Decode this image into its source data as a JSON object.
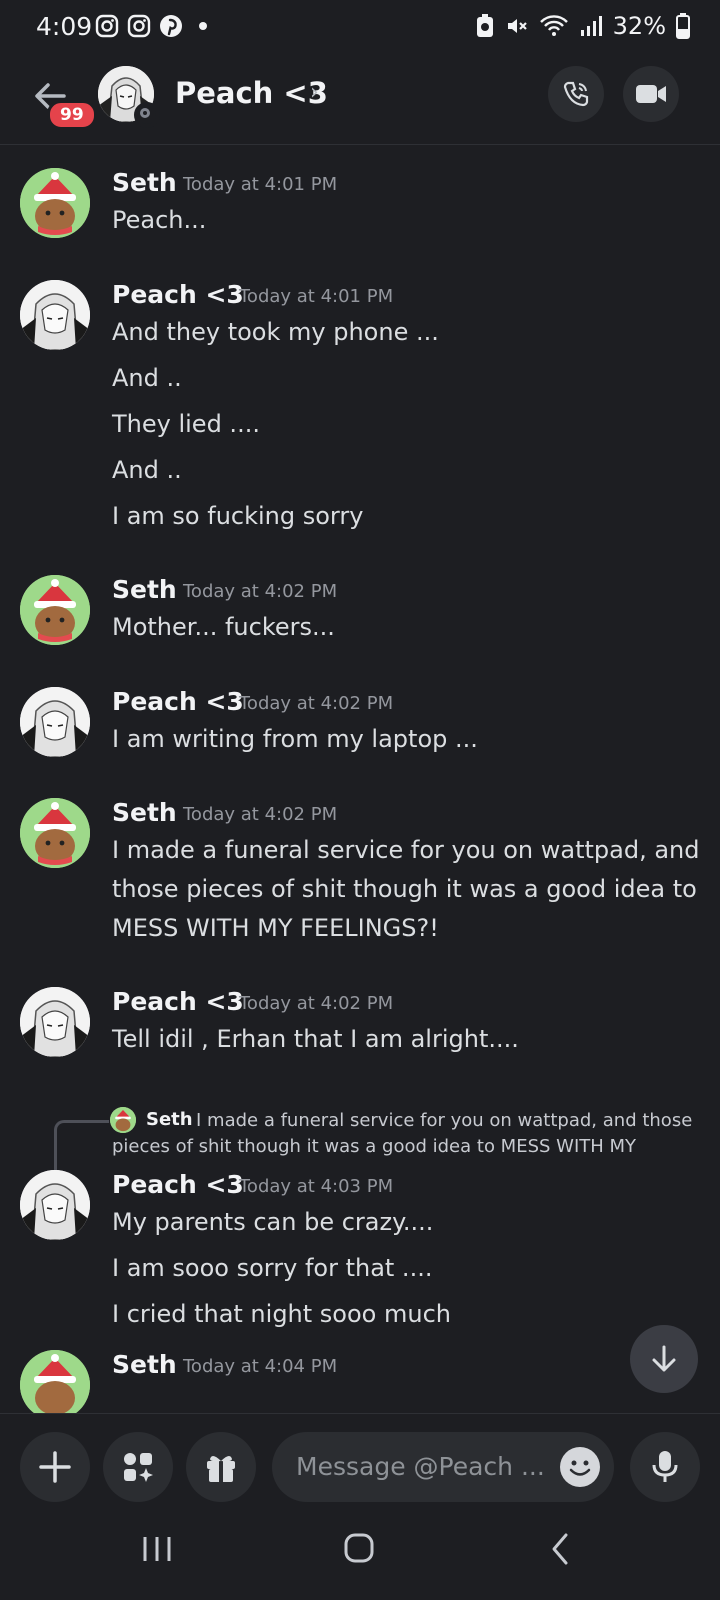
{
  "status_bar": {
    "time": "4:09",
    "battery": "32%",
    "left_icons": [
      "instagram-icon",
      "instagram-icon",
      "pinterest-icon",
      "dot-icon"
    ],
    "right_icons": [
      "battery-saver-icon",
      "mute-icon",
      "wifi-icon",
      "signal-icon",
      "battery-icon"
    ]
  },
  "header": {
    "unread_badge": "99",
    "name": "Peach <3",
    "chevron": "›",
    "call_icon": "phone-icon",
    "video_icon": "video-icon"
  },
  "messages": [
    {
      "author": "Seth",
      "time": "Today at 4:01 PM",
      "lines": [
        "Peach..."
      ]
    },
    {
      "author": "Peach <3",
      "time": "Today at 4:01 PM",
      "lines": [
        "And they took my phone ...",
        "And ..",
        "They lied ....",
        "And ..",
        "I am so fucking sorry"
      ]
    },
    {
      "author": "Seth",
      "time": "Today at 4:02 PM",
      "lines": [
        "Mother... fuckers..."
      ]
    },
    {
      "author": "Peach <3",
      "time": "Today at 4:02 PM",
      "lines": [
        "I am writing from my laptop ..."
      ]
    },
    {
      "author": "Seth",
      "time": "Today at 4:02 PM",
      "lines": [
        "I made a funeral service for you on wattpad, and",
        "those pieces of shit though it was a good idea to",
        "MESS WITH MY FEELINGS?!"
      ]
    },
    {
      "author": "Peach <3",
      "time": "Today at 4:02 PM",
      "lines": [
        "Tell idil , Erhan that I am alright...."
      ]
    },
    {
      "author": "Peach <3",
      "time": "Today at 4:03 PM",
      "lines": [
        "My parents can be crazy....",
        "I am sooo sorry for that ....",
        "I cried that night sooo much"
      ]
    },
    {
      "author": "Seth",
      "time": "Today at 4:04 PM",
      "lines": []
    }
  ],
  "reply_preview": {
    "author": "Seth",
    "text_line1": "I made a funeral service for you on wattpad, and those",
    "text_line2": "pieces of shit though it was a good idea to MESS WITH MY"
  },
  "composer": {
    "placeholder": "Message @Peach ...",
    "buttons": [
      "plus-icon",
      "apps-icon",
      "gift-icon",
      "emoji-icon",
      "microphone-icon"
    ]
  },
  "jump_button_icon": "arrow-down-icon",
  "nav_bar": [
    "recents-icon",
    "home-icon",
    "back-icon"
  ]
}
